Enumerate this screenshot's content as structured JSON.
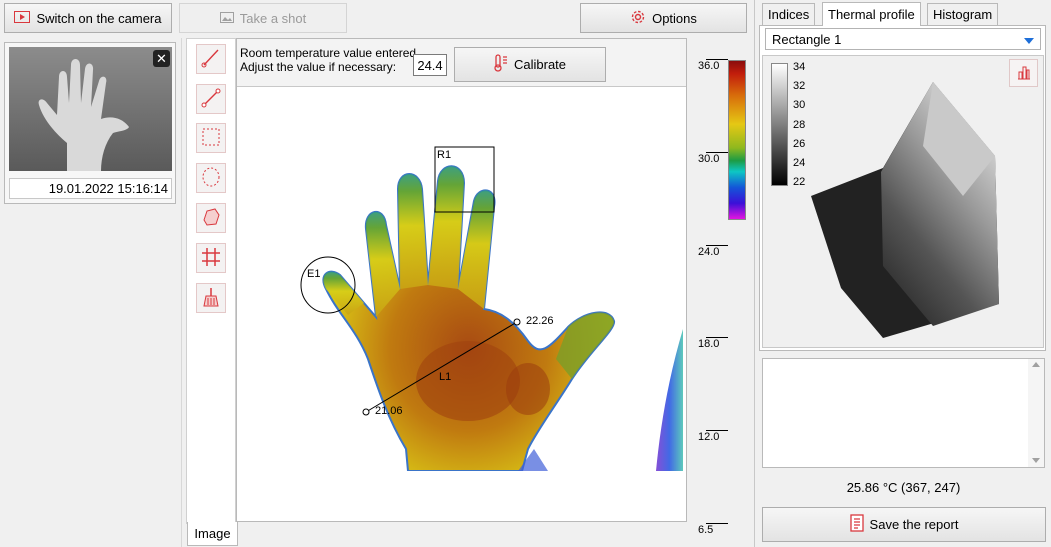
{
  "toolbar": {
    "camera_button": "Switch on the camera",
    "shot_button": "Take a shot",
    "options_button": "Options"
  },
  "thumbnail": {
    "timestamp": "19.01.2022 15:16:14"
  },
  "calibration": {
    "message_line1": "Room temperature value entered.",
    "message_line2": "Adjust the value if necessary:",
    "value": "24.4",
    "button": "Calibrate"
  },
  "image_tab": "Image",
  "annotations": {
    "rect_label": "R1",
    "ellipse_label": "E1",
    "line_label": "L1",
    "line_start_value": "21.06",
    "line_end_value": "22.26"
  },
  "color_scale": {
    "labels": [
      "36.0",
      "30.0",
      "24.0",
      "18.0",
      "12.0",
      "6.5"
    ]
  },
  "right_panel": {
    "tabs": [
      "Indices",
      "Thermal profile",
      "Histogram"
    ],
    "active_tab": "Thermal profile",
    "region_select": "Rectangle 1",
    "gray_scale_labels": [
      "34",
      "32",
      "30",
      "28",
      "26",
      "24",
      "22"
    ],
    "notes": "",
    "status": "25.86 °C (367, 247)",
    "report_button": "Save the report"
  },
  "colors": {
    "accent_red": "#d9383e",
    "select_arrow": "#1e6fd9"
  }
}
